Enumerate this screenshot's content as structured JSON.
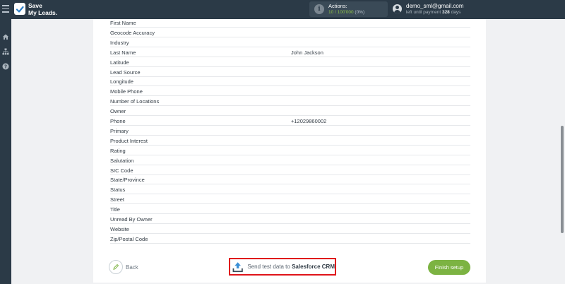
{
  "header": {
    "brand_line1": "Save",
    "brand_line2": "My Leads.",
    "actions_label": "Actions:",
    "actions_used": "10 / 100'000",
    "actions_percent": "(0%)",
    "user_email": "demo_sml@gmail.com",
    "payment_prefix": "left until payment",
    "payment_days": "328",
    "payment_suffix": "days"
  },
  "leftnav": {
    "icons": [
      "home-icon",
      "sitemap-icon",
      "help-icon"
    ]
  },
  "fields": [
    {
      "name": "First Name",
      "value": ""
    },
    {
      "name": "Geocode Accuracy",
      "value": ""
    },
    {
      "name": "Industry",
      "value": ""
    },
    {
      "name": "Last Name",
      "value": "John Jackson"
    },
    {
      "name": "Latitude",
      "value": ""
    },
    {
      "name": "Lead Source",
      "value": ""
    },
    {
      "name": "Longitude",
      "value": ""
    },
    {
      "name": "Mobile Phone",
      "value": ""
    },
    {
      "name": "Number of Locations",
      "value": ""
    },
    {
      "name": "Owner",
      "value": ""
    },
    {
      "name": "Phone",
      "value": "+12029860002"
    },
    {
      "name": "Primary",
      "value": ""
    },
    {
      "name": "Product Interest",
      "value": ""
    },
    {
      "name": "Rating",
      "value": ""
    },
    {
      "name": "Salutation",
      "value": ""
    },
    {
      "name": "SIC Code",
      "value": ""
    },
    {
      "name": "State/Province",
      "value": ""
    },
    {
      "name": "Status",
      "value": ""
    },
    {
      "name": "Street",
      "value": ""
    },
    {
      "name": "Title",
      "value": ""
    },
    {
      "name": "Unread By Owner",
      "value": ""
    },
    {
      "name": "Website",
      "value": ""
    },
    {
      "name": "Zip/Postal Code",
      "value": ""
    }
  ],
  "footer": {
    "back_label": "Back",
    "send_prefix": "Send test data to",
    "send_target": "Salesforce CRM",
    "finish_label": "Finish setup"
  },
  "colors": {
    "topbar": "#2b3a47",
    "accent_green": "#7cb342",
    "highlight_red": "#e0141a",
    "upload_blue": "#3a8fd6"
  }
}
